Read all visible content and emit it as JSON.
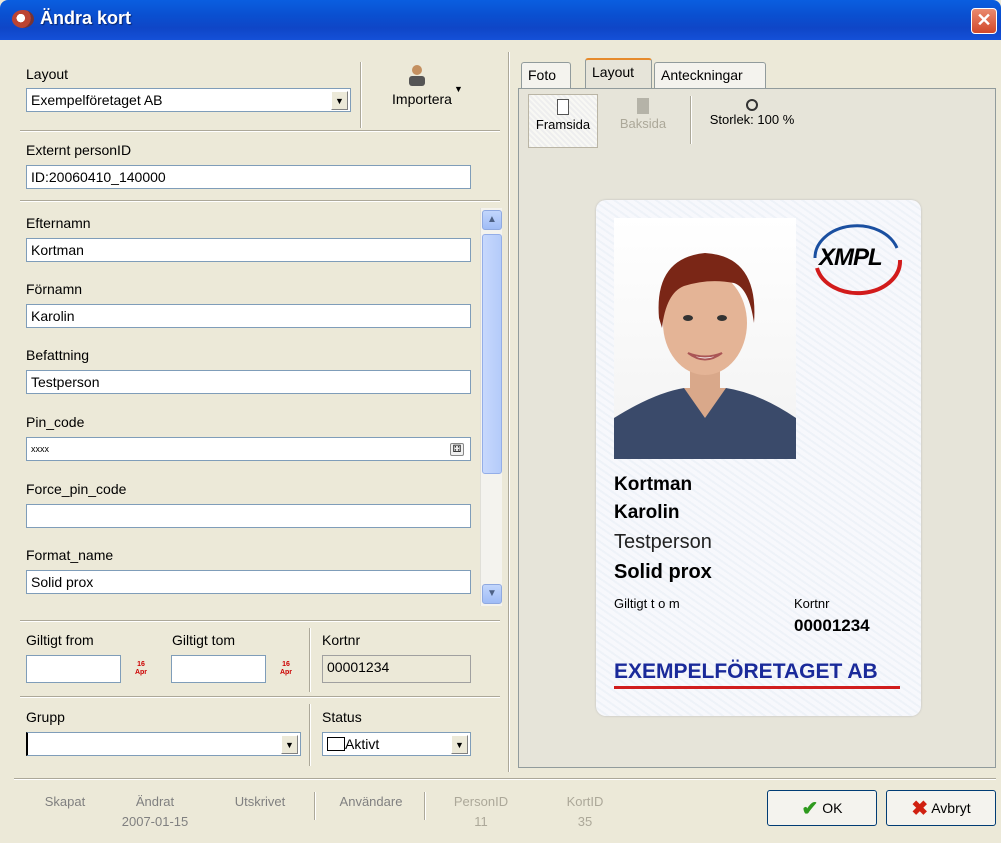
{
  "window": {
    "title": "Ändra kort",
    "close_glyph": "✕"
  },
  "layout": {
    "label": "Layout",
    "value": "Exempelföretaget AB",
    "import_label": "Importera"
  },
  "extern": {
    "label": "Externt personID",
    "value": "ID:20060410_140000"
  },
  "fields": [
    {
      "label": "Efternamn",
      "value": "Kortman"
    },
    {
      "label": "Förnamn",
      "value": "Karolin"
    },
    {
      "label": "Befattning",
      "value": "Testperson"
    },
    {
      "label": "Pin_code",
      "value": "xxxx"
    },
    {
      "label": "Force_pin_code",
      "value": ""
    },
    {
      "label": "Format_name",
      "value": "Solid prox"
    }
  ],
  "dates": {
    "from_label": "Giltigt from",
    "from_value": "",
    "tom_label": "Giltigt tom",
    "tom_value": "",
    "kortnr_label": "Kortnr",
    "kortnr_value": "00001234",
    "cal_text": "16 Apr"
  },
  "grupp": {
    "label": "Grupp",
    "value": ""
  },
  "status": {
    "label": "Status",
    "value": "Aktivt"
  },
  "tabs": {
    "foto": "Foto",
    "layout": "Layout",
    "notes": "Anteckningar"
  },
  "toolbar": {
    "front": "Framsida",
    "back": "Baksida",
    "size": "Storlek: 100 %"
  },
  "card": {
    "logo": "XMPL",
    "surname": "Kortman",
    "firstname": "Karolin",
    "title": "Testperson",
    "format": "Solid prox",
    "valid_label": "Giltigt t o m",
    "kortnr_label": "Kortnr",
    "kortnr_value": "00001234",
    "company": "EXEMPELFÖRETAGET AB",
    "colors": {
      "company": "#1a2a9a",
      "underline": "#d01c1c",
      "logo_blue": "#1a4fa0",
      "logo_red": "#d21b1b"
    }
  },
  "footer": {
    "skapat": "Skapat",
    "andrat": "Ändrat",
    "andrat_value": "2007-01-15",
    "utskrivet": "Utskrivet",
    "anvandare": "Användare",
    "personid": "PersonID",
    "personid_value": "11",
    "kortid": "KortID",
    "kortid_value": "35",
    "ok": "OK",
    "cancel": "Avbryt"
  }
}
